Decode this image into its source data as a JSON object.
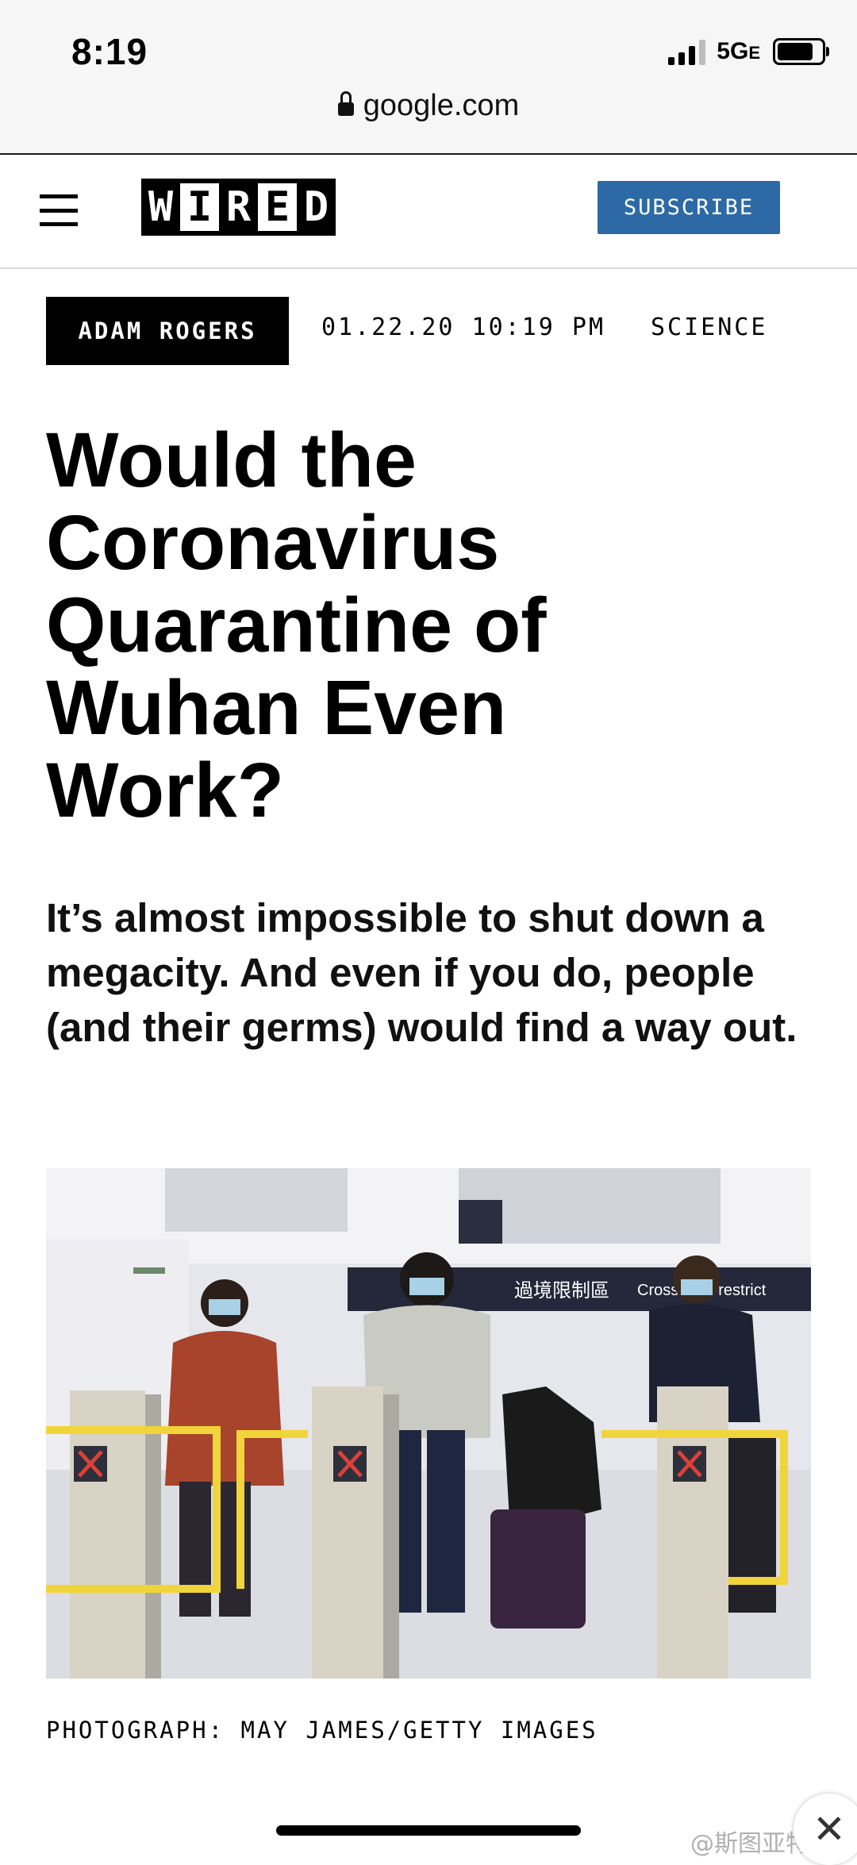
{
  "status_bar": {
    "time": "8:19",
    "network": "5G",
    "network_suffix": "E",
    "battery_level": 0.92
  },
  "url_bar": {
    "domain": "google.com"
  },
  "site_header": {
    "logo_letters": [
      "W",
      "I",
      "R",
      "E",
      "D"
    ],
    "subscribe_label": "SUBSCRIBE",
    "brand_color": "#2d6aa5"
  },
  "article": {
    "author": "ADAM ROGERS",
    "date": "01.22.20 10:19 PM",
    "section": "SCIENCE",
    "headline": "Would the Coronavirus Quarantine of Wuhan Even Work?",
    "dek": "It’s almost impossible to shut down a megacity. And even if you do, people (and their germs) would find a way out.",
    "photo": {
      "sign_chinese": "過境限制區",
      "sign_english": "Cross   dary restrict"
    },
    "photo_credit": "PHOTOGRAPH: MAY JAMES/GETTY IMAGES"
  },
  "overlay": {
    "close_glyph": "✕",
    "watermark": "@斯图亚特9"
  }
}
